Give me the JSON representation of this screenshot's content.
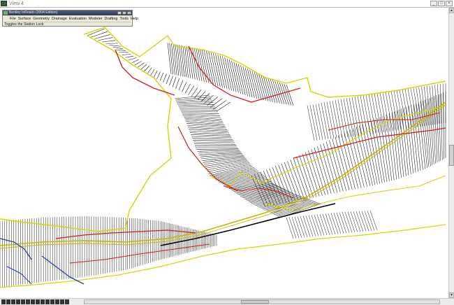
{
  "view_window": {
    "title": "View 4",
    "btn_min": "_",
    "btn_max": "□",
    "btn_close": "×"
  },
  "app_window": {
    "title": "Bentley InRoads (2004 Edition)",
    "menu": [
      "File",
      "Surface",
      "Geometry",
      "Drainage",
      "Evaluation",
      "Modeler",
      "Drafting",
      "Tools",
      "Help"
    ],
    "status": "Toggles the Station Lock"
  },
  "colors": {
    "cross_section_lines": "#1a1a1a",
    "boundary": "#d8d400",
    "breaklines": "#d41a1a",
    "edge_lines": "#2a3fa8",
    "alignment": "#c8b400"
  },
  "icons": {
    "view_window": "view-window-icon",
    "app_window": "inroads-app-icon",
    "scroll_up": "scroll-up-arrow-icon",
    "scroll_down": "scroll-down-arrow-icon"
  }
}
